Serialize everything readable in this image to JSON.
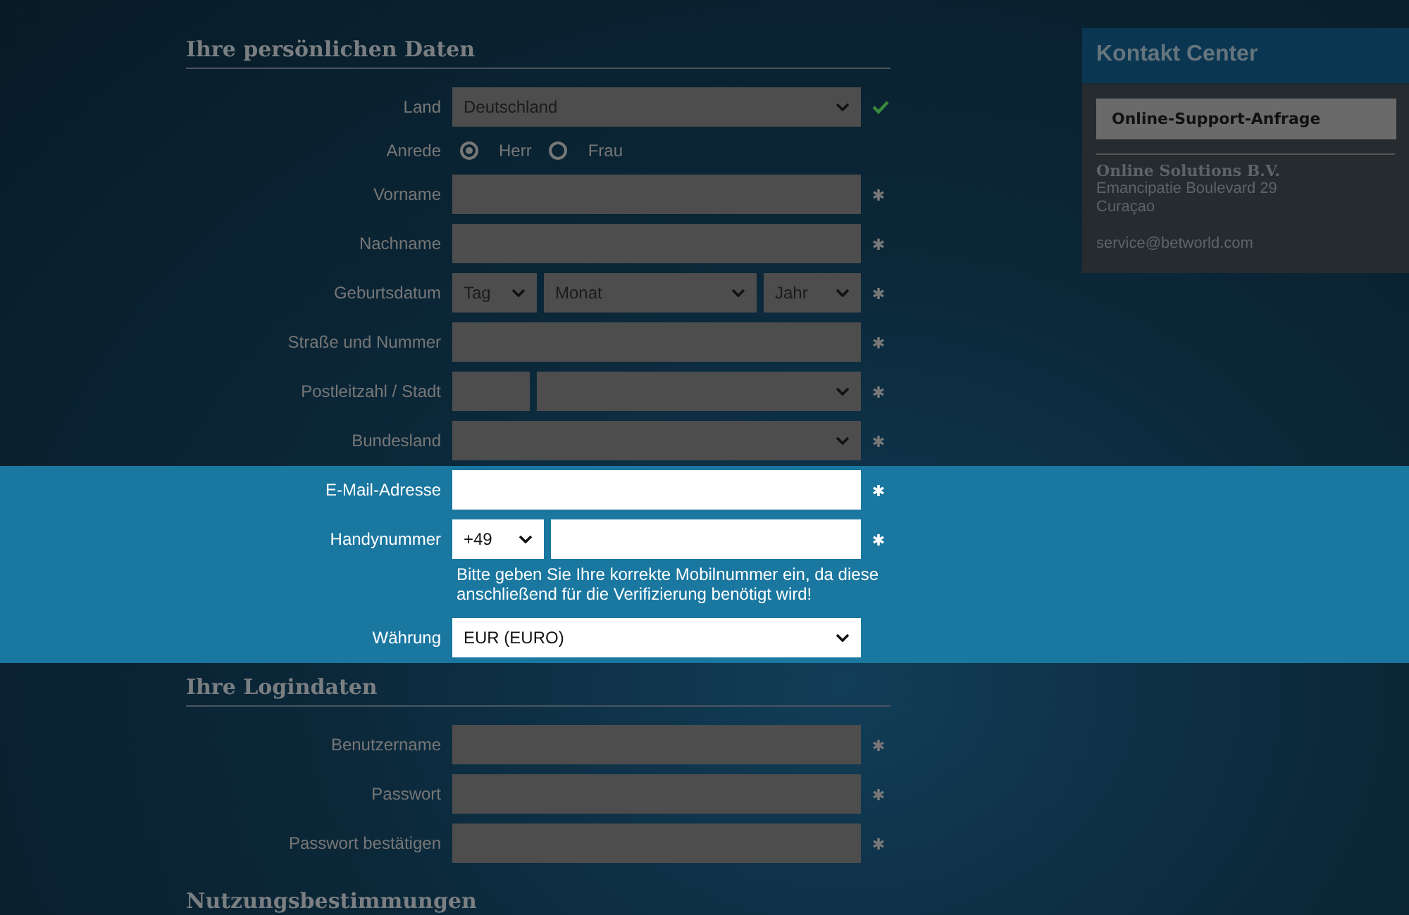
{
  "sections": [
    {
      "title": "Ihre persönlichen Daten",
      "rows": [
        {
          "kind": "select",
          "label": "Land",
          "value": "Deutschland",
          "valid": true,
          "highlighted": false
        },
        {
          "kind": "radio",
          "label": "Anrede",
          "options": [
            {
              "label": "Herr",
              "selected": true
            },
            {
              "label": "Frau",
              "selected": false
            }
          ],
          "highlighted": false
        },
        {
          "kind": "text",
          "label": "Vorname",
          "required": true,
          "highlighted": false
        },
        {
          "kind": "text",
          "label": "Nachname",
          "required": true,
          "highlighted": false
        },
        {
          "kind": "date",
          "label": "Geburtsdatum",
          "parts": [
            {
              "value": "Tag"
            },
            {
              "value": "Monat"
            },
            {
              "value": "Jahr"
            }
          ],
          "required": true,
          "highlighted": false
        },
        {
          "kind": "text",
          "label": "Straße und Nummer",
          "required": true,
          "highlighted": false
        },
        {
          "kind": "zip",
          "label": "Postleitzahl / Stadt",
          "required": true,
          "highlighted": false
        },
        {
          "kind": "select",
          "label": "Bundesland",
          "required": true,
          "highlighted": false
        },
        {
          "kind": "text",
          "label": "E-Mail-Adresse",
          "required": true,
          "highlighted": true
        },
        {
          "kind": "phone",
          "label": "Handynummer",
          "prefix": "+49",
          "hint": "Bitte geben Sie Ihre korrekte Mobilnummer ein, da diese anschließend für die Verifizierung benötigt wird!",
          "required": true,
          "highlighted": true
        },
        {
          "kind": "select",
          "label": "Währung",
          "value": "EUR (EURO)",
          "required": false,
          "highlighted": true
        }
      ]
    },
    {
      "title": "Ihre Logindaten",
      "rows": [
        {
          "kind": "text",
          "label": "Benutzername",
          "required": true,
          "highlighted": false
        },
        {
          "kind": "text",
          "label": "Passwort",
          "required": true,
          "highlighted": false
        },
        {
          "kind": "text",
          "label": "Passwort bestätigen",
          "required": true,
          "highlighted": false
        }
      ]
    },
    {
      "title": "Nutzungsbestimmungen"
    }
  ],
  "contact": {
    "title": "Kontakt Center",
    "button": "Online-Support-Anfrage",
    "company": "Online Solutions B.V.",
    "address_lines": [
      "Emancipatie Boulevard 29",
      "Curaçao"
    ],
    "email": "service@betworld.com"
  }
}
